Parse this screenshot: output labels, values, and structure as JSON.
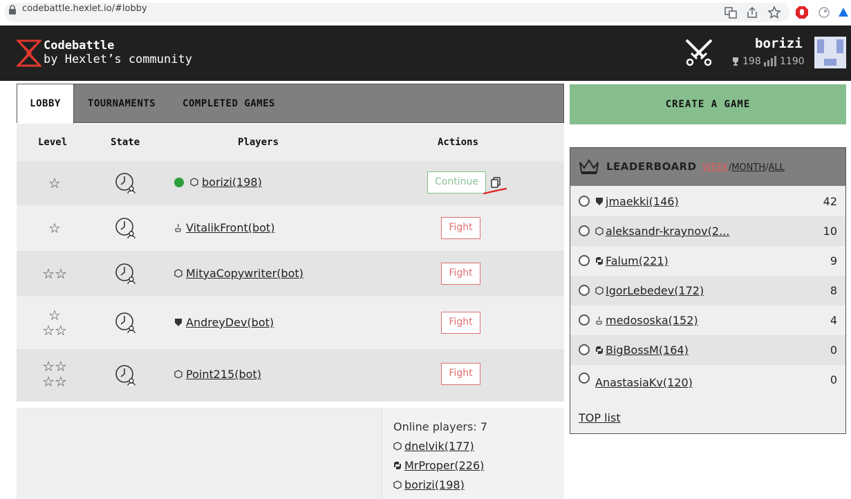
{
  "browser": {
    "url": "codebattle.hexlet.io/#lobby"
  },
  "header": {
    "brand_title": "Codebattle",
    "brand_subtitle": "by Hexlet’s community",
    "user": {
      "name": "borizi",
      "rating": "198",
      "elo": "1190"
    }
  },
  "tabs": [
    {
      "label": "LOBBY",
      "active": true
    },
    {
      "label": "TOURNAMENTS",
      "active": false
    },
    {
      "label": "COMPLETED GAMES",
      "active": false
    }
  ],
  "table": {
    "headers": {
      "level": "Level",
      "state": "State",
      "players": "Players",
      "actions": "Actions"
    },
    "rows": [
      {
        "stars": "☆",
        "player": "borizi(198)",
        "lang_icon": "hexagon-icon",
        "online": true,
        "action": "Continue"
      },
      {
        "stars": "☆",
        "player": "VitalikFront(bot)",
        "lang_icon": "java-cup-icon",
        "action": "Fight"
      },
      {
        "stars": "☆☆",
        "player": "MityaCopywriter(bot)",
        "lang_icon": "hexagon-icon",
        "action": "Fight"
      },
      {
        "stars_top": "☆",
        "stars": "☆☆",
        "player": "AndreyDev(bot)",
        "lang_icon": "php-shield-icon",
        "action": "Fight"
      },
      {
        "stars_top": "☆☆",
        "stars": "☆☆",
        "player": "Point215(bot)",
        "lang_icon": "hexagon-icon",
        "action": "Fight"
      }
    ]
  },
  "online": {
    "title": "Online players: 7",
    "players": [
      {
        "name": "dnelvik(177)",
        "lang_icon": "hexagon-icon"
      },
      {
        "name": "MrProper(226)",
        "lang_icon": "python-icon"
      },
      {
        "name": "borizi(198)",
        "lang_icon": "hexagon-icon"
      }
    ]
  },
  "create_game_label": "CREATE A GAME",
  "leaderboard": {
    "title": "LEADERBOARD",
    "periods": [
      "WEEK",
      "MONTH",
      "ALL"
    ],
    "separator": "/",
    "entries": [
      {
        "name": "jmaekki(146)",
        "lang_icon": "php-shield-icon",
        "score": "42"
      },
      {
        "name": "aleksandr-kraynov(2...",
        "lang_icon": "hexagon-icon",
        "score": "10"
      },
      {
        "name": "Falum(221)",
        "lang_icon": "python-icon",
        "score": "9"
      },
      {
        "name": "IgorLebedev(172)",
        "lang_icon": "hexagon-icon",
        "score": "8"
      },
      {
        "name": "medososka(152)",
        "lang_icon": "java-cup-icon",
        "score": "4"
      },
      {
        "name": "BigBossM(164)",
        "lang_icon": "python-icon",
        "score": "0"
      },
      {
        "name": "AnastasiaKv(120)",
        "lang_icon": "",
        "score": "0"
      }
    ],
    "top_list_label": "TOP list"
  },
  "colors": {
    "header_bg": "#202020",
    "create_btn": "#86be8d",
    "fight": "#e07070",
    "continue": "#7ec48a",
    "online_dot": "#2e9e3c"
  }
}
